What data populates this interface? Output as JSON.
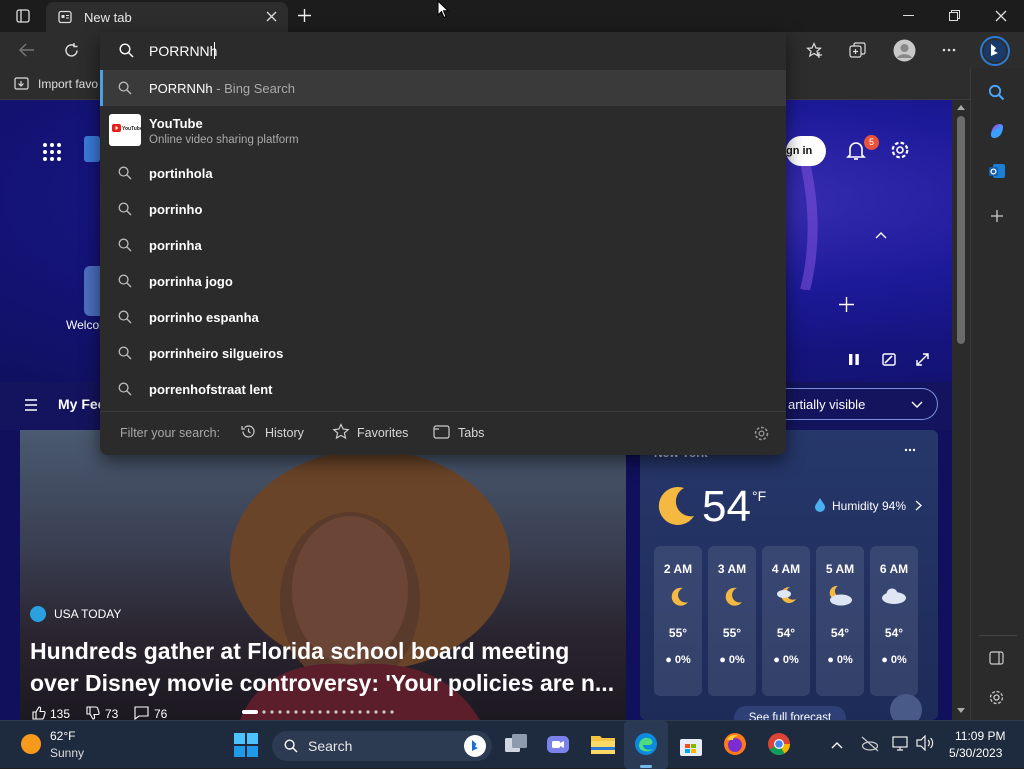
{
  "browser": {
    "tab_title": "New tab",
    "favorites_bar_label": "Import favo"
  },
  "address_bar": {
    "value": "PORRNNh"
  },
  "suggestions": {
    "top": {
      "text": "PORRNNh",
      "suffix": " - Bing Search"
    },
    "youtube": {
      "title": "YouTube",
      "subtitle": "Online video sharing platform",
      "logo_text": "YouTube"
    },
    "items": [
      "portinhola",
      "porrinho",
      "porrinha",
      "porrinha jogo",
      "porrinho espanha",
      "porrinheiro silgueiros",
      "porrenhofstraat lent"
    ]
  },
  "filter": {
    "label": "Filter your search:",
    "history": "History",
    "favorites": "Favorites",
    "tabs": "Tabs"
  },
  "page": {
    "sign_in": "gn in",
    "notification_count": "5",
    "welcome": "Welcol",
    "my_feed": "My Fee",
    "visibility": "artially visible"
  },
  "news": {
    "source": "USA TODAY",
    "headline_line1": "Hundreds gather at Florida school board meeting",
    "headline_line2": "over Disney movie controversy: 'Your policies are n...",
    "likes": "135",
    "dislikes": "73",
    "comments": "76"
  },
  "weather": {
    "city": "New York",
    "temp": "54",
    "unit": "°F",
    "humidity": "Humidity 94%",
    "hours": [
      {
        "h": "2 AM",
        "t": "55°",
        "p": "0%",
        "icon": "moon-icon"
      },
      {
        "h": "3 AM",
        "t": "55°",
        "p": "0%",
        "icon": "moon-icon"
      },
      {
        "h": "4 AM",
        "t": "54°",
        "p": "0%",
        "icon": "moon-cloud-icon"
      },
      {
        "h": "5 AM",
        "t": "54°",
        "p": "0%",
        "icon": "moon-cloud-icon"
      },
      {
        "h": "6 AM",
        "t": "54°",
        "p": "0%",
        "icon": "cloud-icon"
      }
    ],
    "full_forecast": "See full forecast"
  },
  "taskbar": {
    "weather_temp": "62°F",
    "weather_desc": "Sunny",
    "search_placeholder": "Search",
    "time": "11:09 PM",
    "date": "5/30/2023"
  },
  "colors": {
    "accent": "#4ca0e0",
    "dropdown_bg": "#2b2b2b",
    "hero_bg": "#1d1a9a",
    "notification_badge": "#e8533b"
  }
}
